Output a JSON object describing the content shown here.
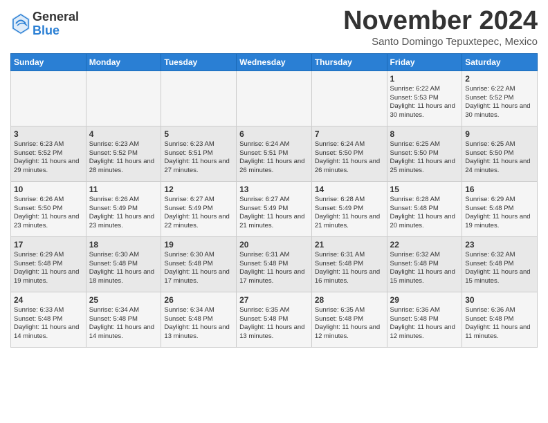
{
  "logo": {
    "general": "General",
    "blue": "Blue"
  },
  "title": "November 2024",
  "location": "Santo Domingo Tepuxtepec, Mexico",
  "days_of_week": [
    "Sunday",
    "Monday",
    "Tuesday",
    "Wednesday",
    "Thursday",
    "Friday",
    "Saturday"
  ],
  "weeks": [
    [
      {
        "day": "",
        "info": ""
      },
      {
        "day": "",
        "info": ""
      },
      {
        "day": "",
        "info": ""
      },
      {
        "day": "",
        "info": ""
      },
      {
        "day": "",
        "info": ""
      },
      {
        "day": "1",
        "info": "Sunrise: 6:22 AM\nSunset: 5:53 PM\nDaylight: 11 hours and 30 minutes."
      },
      {
        "day": "2",
        "info": "Sunrise: 6:22 AM\nSunset: 5:52 PM\nDaylight: 11 hours and 30 minutes."
      }
    ],
    [
      {
        "day": "3",
        "info": "Sunrise: 6:23 AM\nSunset: 5:52 PM\nDaylight: 11 hours and 29 minutes."
      },
      {
        "day": "4",
        "info": "Sunrise: 6:23 AM\nSunset: 5:52 PM\nDaylight: 11 hours and 28 minutes."
      },
      {
        "day": "5",
        "info": "Sunrise: 6:23 AM\nSunset: 5:51 PM\nDaylight: 11 hours and 27 minutes."
      },
      {
        "day": "6",
        "info": "Sunrise: 6:24 AM\nSunset: 5:51 PM\nDaylight: 11 hours and 26 minutes."
      },
      {
        "day": "7",
        "info": "Sunrise: 6:24 AM\nSunset: 5:50 PM\nDaylight: 11 hours and 26 minutes."
      },
      {
        "day": "8",
        "info": "Sunrise: 6:25 AM\nSunset: 5:50 PM\nDaylight: 11 hours and 25 minutes."
      },
      {
        "day": "9",
        "info": "Sunrise: 6:25 AM\nSunset: 5:50 PM\nDaylight: 11 hours and 24 minutes."
      }
    ],
    [
      {
        "day": "10",
        "info": "Sunrise: 6:26 AM\nSunset: 5:50 PM\nDaylight: 11 hours and 23 minutes."
      },
      {
        "day": "11",
        "info": "Sunrise: 6:26 AM\nSunset: 5:49 PM\nDaylight: 11 hours and 23 minutes."
      },
      {
        "day": "12",
        "info": "Sunrise: 6:27 AM\nSunset: 5:49 PM\nDaylight: 11 hours and 22 minutes."
      },
      {
        "day": "13",
        "info": "Sunrise: 6:27 AM\nSunset: 5:49 PM\nDaylight: 11 hours and 21 minutes."
      },
      {
        "day": "14",
        "info": "Sunrise: 6:28 AM\nSunset: 5:49 PM\nDaylight: 11 hours and 21 minutes."
      },
      {
        "day": "15",
        "info": "Sunrise: 6:28 AM\nSunset: 5:48 PM\nDaylight: 11 hours and 20 minutes."
      },
      {
        "day": "16",
        "info": "Sunrise: 6:29 AM\nSunset: 5:48 PM\nDaylight: 11 hours and 19 minutes."
      }
    ],
    [
      {
        "day": "17",
        "info": "Sunrise: 6:29 AM\nSunset: 5:48 PM\nDaylight: 11 hours and 19 minutes."
      },
      {
        "day": "18",
        "info": "Sunrise: 6:30 AM\nSunset: 5:48 PM\nDaylight: 11 hours and 18 minutes."
      },
      {
        "day": "19",
        "info": "Sunrise: 6:30 AM\nSunset: 5:48 PM\nDaylight: 11 hours and 17 minutes."
      },
      {
        "day": "20",
        "info": "Sunrise: 6:31 AM\nSunset: 5:48 PM\nDaylight: 11 hours and 17 minutes."
      },
      {
        "day": "21",
        "info": "Sunrise: 6:31 AM\nSunset: 5:48 PM\nDaylight: 11 hours and 16 minutes."
      },
      {
        "day": "22",
        "info": "Sunrise: 6:32 AM\nSunset: 5:48 PM\nDaylight: 11 hours and 15 minutes."
      },
      {
        "day": "23",
        "info": "Sunrise: 6:32 AM\nSunset: 5:48 PM\nDaylight: 11 hours and 15 minutes."
      }
    ],
    [
      {
        "day": "24",
        "info": "Sunrise: 6:33 AM\nSunset: 5:48 PM\nDaylight: 11 hours and 14 minutes."
      },
      {
        "day": "25",
        "info": "Sunrise: 6:34 AM\nSunset: 5:48 PM\nDaylight: 11 hours and 14 minutes."
      },
      {
        "day": "26",
        "info": "Sunrise: 6:34 AM\nSunset: 5:48 PM\nDaylight: 11 hours and 13 minutes."
      },
      {
        "day": "27",
        "info": "Sunrise: 6:35 AM\nSunset: 5:48 PM\nDaylight: 11 hours and 13 minutes."
      },
      {
        "day": "28",
        "info": "Sunrise: 6:35 AM\nSunset: 5:48 PM\nDaylight: 11 hours and 12 minutes."
      },
      {
        "day": "29",
        "info": "Sunrise: 6:36 AM\nSunset: 5:48 PM\nDaylight: 11 hours and 12 minutes."
      },
      {
        "day": "30",
        "info": "Sunrise: 6:36 AM\nSunset: 5:48 PM\nDaylight: 11 hours and 11 minutes."
      }
    ]
  ]
}
